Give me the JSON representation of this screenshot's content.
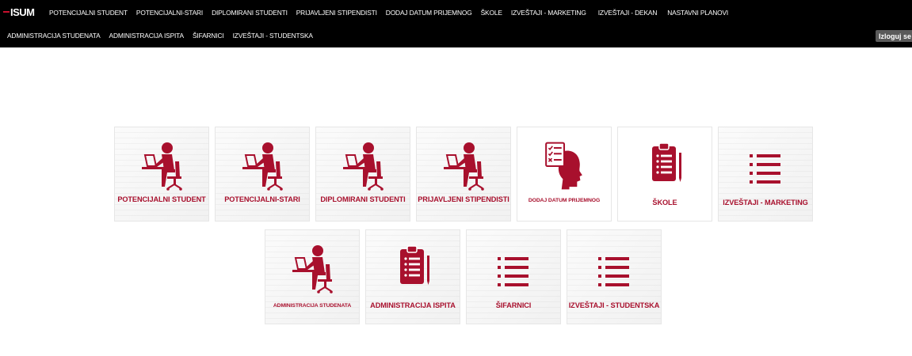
{
  "logo": {
    "text": "ISUM"
  },
  "nav": {
    "row1": [
      "POTENCIJALNI STUDENT",
      "POTENCIJALNI-STARI",
      "DIPLOMIRANI STUDENTI",
      "PRIJAVLJENI STIPENDISTI",
      "DODAJ DATUM PRIJEMNOG",
      "ŠKOLE",
      "IZVEŠTAJI - MARKETING",
      "IZVEŠTAJI - DEKAN",
      "NASTAVNI PLANOVI"
    ],
    "row2": [
      "ADMINISTRACIJA STUDENATA",
      "ADMINISTRACIJA ISPITA",
      "ŠIFARNICI",
      "IZVEŠTAJI - STUDENTSKA"
    ],
    "logout": "Izloguj se"
  },
  "colors": {
    "accent": "#a8102d",
    "navbar": "#000000"
  },
  "tiles": [
    {
      "label": "POTENCIJALNI STUDENT",
      "icon": "person-at-desk-icon"
    },
    {
      "label": "POTENCIJALNI-STARI",
      "icon": "person-at-desk-icon"
    },
    {
      "label": "DIPLOMIRANI STUDENTI",
      "icon": "person-at-desk-icon"
    },
    {
      "label": "PRIJAVLJENI STIPENDISTI",
      "icon": "person-at-desk-icon"
    },
    {
      "label": "DODAJ DATUM PRIJEMNOG",
      "icon": "head-checklist-icon"
    },
    {
      "label": "ŠKOLE",
      "icon": "clipboard-icon"
    },
    {
      "label": "IZVEŠTAJI - MARKETING",
      "icon": "list-icon"
    },
    {
      "label": "ADMINISTRACIJA STUDENATA",
      "icon": "person-at-desk-icon"
    },
    {
      "label": "ADMINISTRACIJA ISPITA",
      "icon": "clipboard-icon"
    },
    {
      "label": "ŠIFARNICI",
      "icon": "list-icon"
    },
    {
      "label": "IZVEŠTAJI - STUDENTSKA",
      "icon": "list-icon"
    }
  ]
}
